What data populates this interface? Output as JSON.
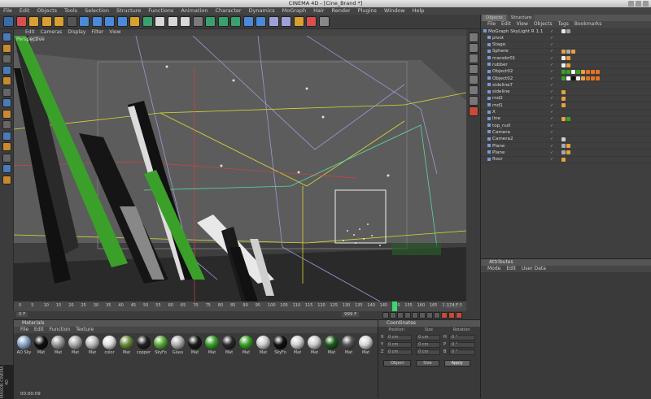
{
  "window": {
    "title": "CINEMA 4D - [Cine_Brand *]"
  },
  "menu": [
    "File",
    "Edit",
    "Objects",
    "Tools",
    "Selection",
    "Structure",
    "Functions",
    "Animation",
    "Character",
    "Dynamics",
    "MoGraph",
    "Hair",
    "Render",
    "Plugins",
    "Window",
    "Help"
  ],
  "viewport": {
    "label": "Perspective",
    "menu": [
      "Edit",
      "Cameras",
      "Display",
      "Filter",
      "View"
    ]
  },
  "timeline": {
    "ticks": [
      "0",
      "5",
      "10",
      "15",
      "20",
      "25",
      "30",
      "35",
      "40",
      "45",
      "50",
      "55",
      "60",
      "65",
      "70",
      "75",
      "80",
      "85",
      "90",
      "95",
      "100",
      "105",
      "110",
      "115",
      "120",
      "125",
      "130",
      "135",
      "140",
      "145",
      "150",
      "155",
      "160",
      "165",
      "170",
      "175"
    ],
    "current": "174 F",
    "start": "0 F",
    "end": "999 F"
  },
  "materials": {
    "title": "Materials",
    "menu": [
      "File",
      "Edit",
      "Function",
      "Texture"
    ],
    "items": [
      {
        "label": "AO Sky",
        "color": "#8aa8c8"
      },
      {
        "label": "Mat",
        "color": "#111111"
      },
      {
        "label": "Mat",
        "color": "#9a9a9a"
      },
      {
        "label": "Mat",
        "color": "#aaaaaa"
      },
      {
        "label": "Mat",
        "color": "#bbbbbb"
      },
      {
        "label": "color",
        "color": "#e0e0e0"
      },
      {
        "label": "Mat",
        "color": "#6a8a3a"
      },
      {
        "label": "copper",
        "color": "#222222"
      },
      {
        "label": "SkyFo",
        "color": "#5aaa3a"
      },
      {
        "label": "Glass",
        "color": "#b0b0b0"
      },
      {
        "label": "Mat",
        "color": "#1a1a1a"
      },
      {
        "label": "Mat",
        "color": "#3aa02a"
      },
      {
        "label": "Mat",
        "color": "#2a2a2a"
      },
      {
        "label": "Mat",
        "color": "#3aa02a"
      },
      {
        "label": "Mat",
        "color": "#cccccc"
      },
      {
        "label": "SkyFo",
        "color": "#111111"
      },
      {
        "label": "Mat",
        "color": "#d0d0d0"
      },
      {
        "label": "Mat",
        "color": "#cccccc"
      },
      {
        "label": "Mat",
        "color": "#1c5a1c"
      },
      {
        "label": "Mat",
        "color": "#555555"
      },
      {
        "label": "Mat",
        "color": "#d8d8d8"
      }
    ]
  },
  "coordinates": {
    "title": "Coordinates",
    "position": "Position",
    "size": "Size",
    "rotation": "Rotation",
    "rows": [
      {
        "axis": "X",
        "pos": "0 cm",
        "size": "0 cm",
        "rl": "H",
        "rot": "0 °"
      },
      {
        "axis": "Y",
        "pos": "0 cm",
        "size": "0 cm",
        "rl": "P",
        "rot": "0 °"
      },
      {
        "axis": "Z",
        "pos": "0 cm",
        "size": "0 cm",
        "rl": "B",
        "rot": "0 °"
      }
    ],
    "mode1": "Object",
    "mode2": "Size",
    "apply": "Apply"
  },
  "objects": {
    "tabs": [
      "Objects",
      "Structure"
    ],
    "menu": [
      "File",
      "Edit",
      "View",
      "Objects",
      "Tags",
      "Bookmarks"
    ],
    "rows": [
      {
        "name": "MoGraph SkyLight R 1.1",
        "indent": 0,
        "tags": [
          "#e8e8e8",
          "#a0a0a0"
        ]
      },
      {
        "name": "pivot",
        "indent": 1,
        "tags": []
      },
      {
        "name": "Stage",
        "indent": 1,
        "tags": []
      },
      {
        "name": "Sphere",
        "indent": 1,
        "tags": [
          "#e8a040",
          "#aaaaaa",
          "#e8a040"
        ]
      },
      {
        "name": "macebr01",
        "indent": 1,
        "tags": [
          "#eeeeee",
          "#e8a040"
        ]
      },
      {
        "name": "rubber",
        "indent": 1,
        "tags": [
          "#eeeeee",
          "#e8a040"
        ]
      },
      {
        "name": "Object02",
        "indent": 1,
        "tags": [
          "#3aa02a",
          "#3aa02a",
          "#ffffff",
          "#3aa02a",
          "#e8a040",
          "#e87020",
          "#e87020",
          "#e87020"
        ]
      },
      {
        "name": "Object02",
        "indent": 1,
        "tags": [
          "#3aa02a",
          "#ffffff",
          "#111111",
          "#eeeeee",
          "#e8a040",
          "#e87020",
          "#e87020",
          "#e87020"
        ]
      },
      {
        "name": "sideline7",
        "indent": 1,
        "tags": []
      },
      {
        "name": "sideline",
        "indent": 1,
        "tags": [
          "#e8a040"
        ]
      },
      {
        "name": "rnd2",
        "indent": 1,
        "tags": [
          "#e8a040"
        ]
      },
      {
        "name": "rnd1",
        "indent": 1,
        "tags": [
          "#e8a040"
        ]
      },
      {
        "name": "X",
        "indent": 1,
        "tags": []
      },
      {
        "name": "line",
        "indent": 1,
        "tags": [
          "#e8a040",
          "#3aa02a"
        ]
      },
      {
        "name": "top_null",
        "indent": 1,
        "tags": []
      },
      {
        "name": "Camera",
        "indent": 1,
        "tags": []
      },
      {
        "name": "Camera2",
        "indent": 1,
        "tags": [
          "#cccccc"
        ]
      },
      {
        "name": "Plane",
        "indent": 1,
        "tags": [
          "#aaaaaa",
          "#e8a040"
        ]
      },
      {
        "name": "Plane",
        "indent": 1,
        "tags": [
          "#aaaaaa",
          "#e8a040"
        ]
      },
      {
        "name": "floor",
        "indent": 1,
        "tags": [
          "#e8a040"
        ]
      }
    ]
  },
  "attributes": {
    "title": "Attributes",
    "menu": [
      "Mode",
      "Edit",
      "User Data"
    ]
  },
  "status": {
    "time": "00:00:09"
  },
  "brand": "MAXON CINEMA 4D",
  "colors": {
    "accent_green": "#3aa02a",
    "tag_orange": "#e8a040",
    "wire_yellow": "#d8d830"
  }
}
